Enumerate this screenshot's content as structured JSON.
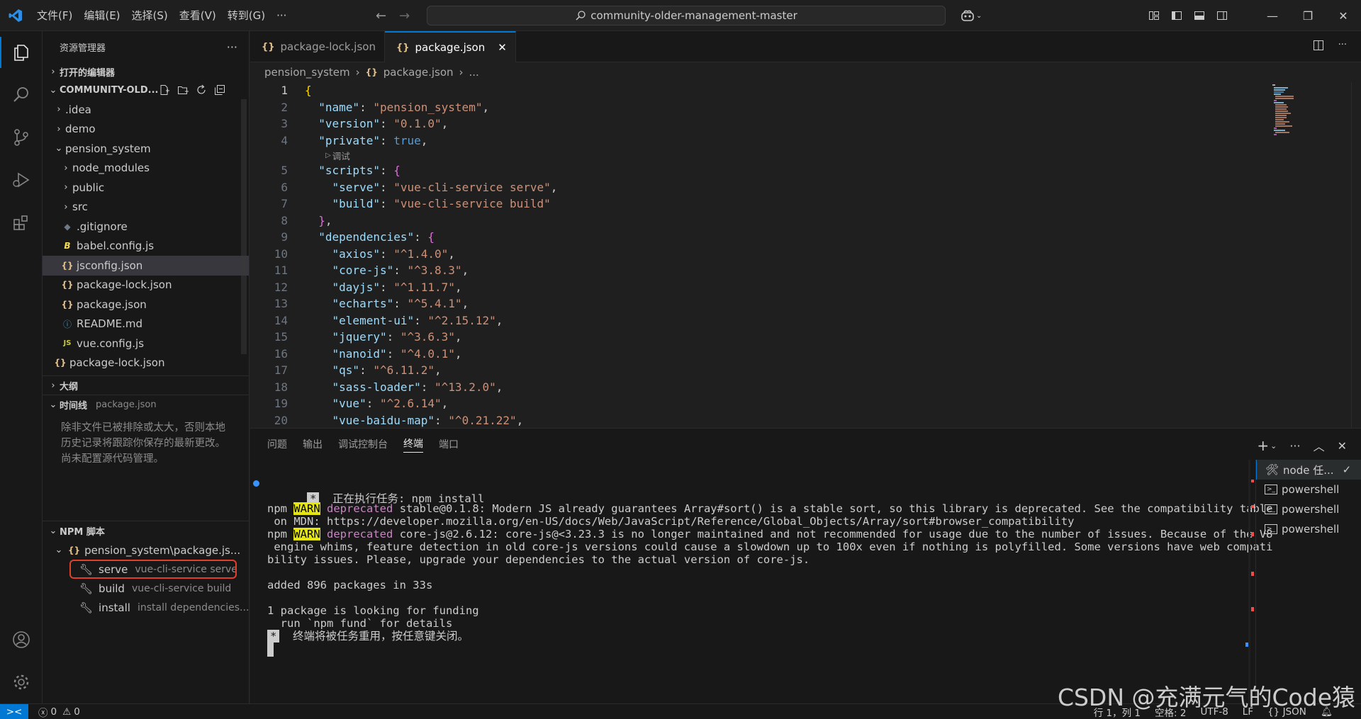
{
  "titlebar": {
    "menu": [
      "文件(F)",
      "编辑(E)",
      "选择(S)",
      "查看(V)",
      "转到(G)",
      "···"
    ],
    "search_text": "community-older-management-master"
  },
  "sidebar": {
    "title": "资源管理器",
    "open_editors": "打开的编辑器",
    "project": "COMMUNITY-OLD...",
    "tree": [
      {
        "label": ".idea",
        "type": "folder",
        "depth": 1
      },
      {
        "label": "demo",
        "type": "folder",
        "depth": 1
      },
      {
        "label": "pension_system",
        "type": "folder-open",
        "depth": 1
      },
      {
        "label": "node_modules",
        "type": "folder",
        "depth": 2
      },
      {
        "label": "public",
        "type": "folder",
        "depth": 2
      },
      {
        "label": "src",
        "type": "folder",
        "depth": 2
      },
      {
        "label": ".gitignore",
        "type": "gitignore",
        "depth": 2
      },
      {
        "label": "babel.config.js",
        "type": "babel",
        "depth": 2
      },
      {
        "label": "jsconfig.json",
        "type": "json",
        "depth": 2,
        "selected": true
      },
      {
        "label": "package-lock.json",
        "type": "json",
        "depth": 2
      },
      {
        "label": "package.json",
        "type": "json",
        "depth": 2
      },
      {
        "label": "README.md",
        "type": "info",
        "depth": 2
      },
      {
        "label": "vue.config.js",
        "type": "js",
        "depth": 2
      },
      {
        "label": "package-lock.json",
        "type": "json",
        "depth": 1
      }
    ],
    "outline": "大纲",
    "timeline": {
      "label": "时间线",
      "file": "package.json",
      "message": "除非文件已被排除或太大，否则本地历史记录将跟踪你保存的最新更改。 尚未配置源代码管理。"
    },
    "npm": {
      "label": "NPM 脚本",
      "package": "pension_system\\package.js...",
      "scripts": [
        {
          "name": "serve",
          "command": "vue-cli-service serve"
        },
        {
          "name": "build",
          "command": "vue-cli-service build"
        },
        {
          "name": "install",
          "command": "install dependencies..."
        }
      ]
    }
  },
  "editor": {
    "tabs": [
      {
        "label": "package-lock.json",
        "active": false
      },
      {
        "label": "package.json",
        "active": true
      }
    ],
    "breadcrumb": {
      "folder": "pension_system",
      "file": "package.json",
      "rest": "..."
    },
    "codelens": "调试"
  },
  "code": {
    "name": "\"pension_system\"",
    "version": "\"0.1.0\"",
    "private": "true",
    "scripts": [
      {
        "key": "\"serve\"",
        "value": "\"vue-cli-service serve\""
      },
      {
        "key": "\"build\"",
        "value": "\"vue-cli-service build\""
      }
    ],
    "dependencies": [
      {
        "key": "\"axios\"",
        "value": "\"^1.4.0\""
      },
      {
        "key": "\"core-js\"",
        "value": "\"^3.8.3\""
      },
      {
        "key": "\"dayjs\"",
        "value": "\"^1.11.7\""
      },
      {
        "key": "\"echarts\"",
        "value": "\"^5.4.1\""
      },
      {
        "key": "\"element-ui\"",
        "value": "\"^2.15.12\""
      },
      {
        "key": "\"jquery\"",
        "value": "\"^3.6.3\""
      },
      {
        "key": "\"nanoid\"",
        "value": "\"^4.0.1\""
      },
      {
        "key": "\"qs\"",
        "value": "\"^6.11.2\""
      },
      {
        "key": "\"sass-loader\"",
        "value": "\"^13.2.0\""
      },
      {
        "key": "\"vue\"",
        "value": "\"^2.6.14\""
      },
      {
        "key": "\"vue-baidu-map\"",
        "value": "\"^0.21.22\""
      }
    ]
  },
  "panel": {
    "tabs": [
      "问题",
      "输出",
      "调试控制台",
      "终端",
      "端口"
    ],
    "active_tab": "终端",
    "terminal": {
      "task_line": "正在执行任务: npm install",
      "warn1_pkg": "stable@0.1.8: Modern JS already guarantees Array#sort() is a stable sort, so this library is deprecated. See the compatibility table",
      "warn1_cont": " on MDN: https://developer.mozilla.org/en-US/docs/Web/JavaScript/Reference/Global_Objects/Array/sort#browser_compatibility",
      "warn2_pkg": "core-js@2.6.12: core-js@<3.23.3 is no longer maintained and not recommended for usage due to the number of issues. Because of the V8",
      "warn2_cont1": " engine whims, feature detection in old core-js versions could cause a slowdown up to 100x even if nothing is polyfilled. Some versions have web compati",
      "warn2_cont2": "bility issues. Please, upgrade your dependencies to the actual version of core-js.",
      "npm": "npm",
      "warn": "WARN",
      "deprecated": "deprecated",
      "added": "added 896 packages in 33s",
      "funding1": "1 package is looking for funding",
      "funding2": "  run `npm fund` for details",
      "reuse": "终端将被任务重用，按任意键关闭。",
      "star": "*"
    },
    "terminals": [
      {
        "label": "node 任...",
        "active": true
      },
      {
        "label": "powershell",
        "active": false
      },
      {
        "label": "powershell",
        "active": false
      },
      {
        "label": "powershell",
        "active": false
      }
    ]
  },
  "statusbar": {
    "errors": "0",
    "warnings": "0",
    "position": "行 1，列 1",
    "spaces": "空格: 2",
    "encoding": "UTF-8",
    "eol": "LF",
    "language": "JSON"
  },
  "watermark": "CSDN @充满元气的Code猿"
}
